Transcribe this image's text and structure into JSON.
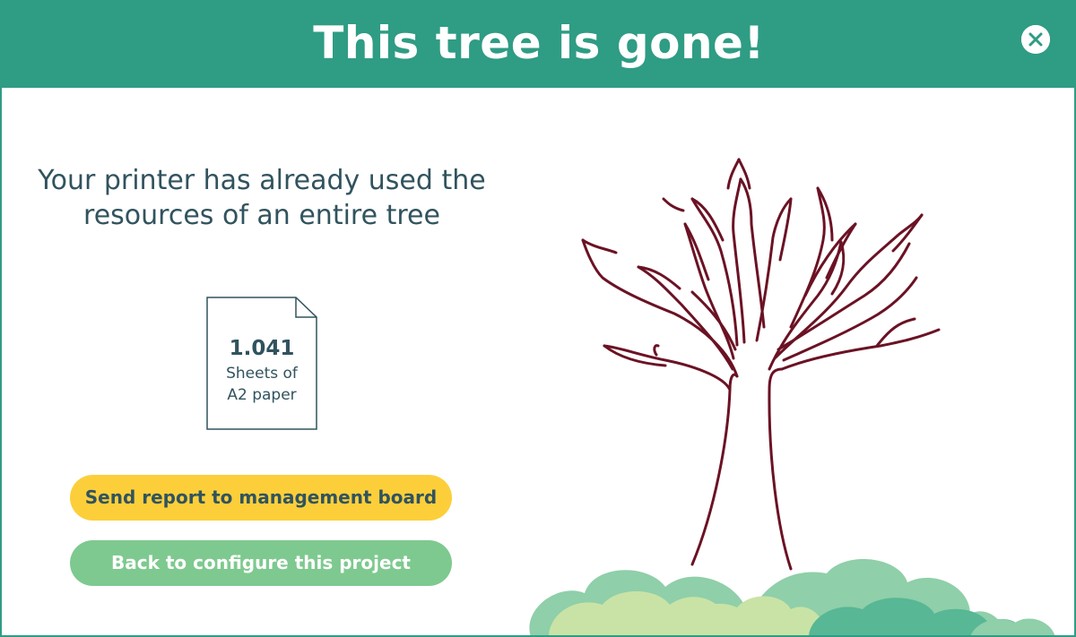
{
  "dialog": {
    "title": "This tree is gone!",
    "message": "Your printer has already used the resources of an entire tree"
  },
  "paper": {
    "count": "1.041",
    "description": "Sheets of A2 paper"
  },
  "buttons": {
    "report_label": "Send report to management board",
    "back_label": "Back to configure this project"
  },
  "icons": {
    "close": "close-icon",
    "sheet": "paper-sheet-icon",
    "tree": "bare-tree-illustration"
  },
  "colors": {
    "header": "#2f9c84",
    "text": "#31535e",
    "report_button": "#fccf3a",
    "back_button": "#7ec98f",
    "tree_outline": "#6b1224",
    "bush_light": "#c9e3a6",
    "bush_mid": "#8fcfa9",
    "bush_dark": "#58b795"
  }
}
